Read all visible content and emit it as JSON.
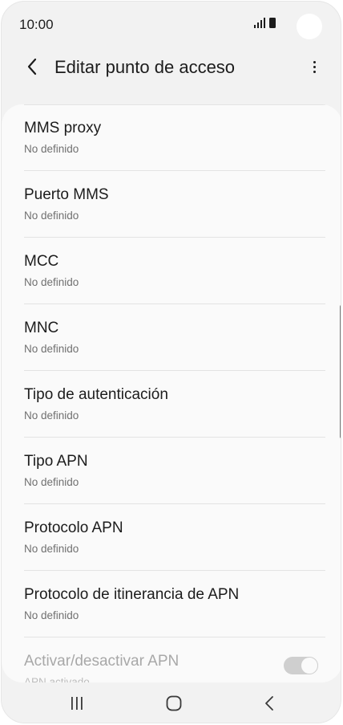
{
  "status_bar": {
    "time": "10:00"
  },
  "app_bar": {
    "title": "Editar punto de acceso"
  },
  "items": [
    {
      "title": "MMS proxy",
      "subtitle": "No definido"
    },
    {
      "title": "Puerto MMS",
      "subtitle": "No definido"
    },
    {
      "title": "MCC",
      "subtitle": "No definido"
    },
    {
      "title": "MNC",
      "subtitle": "No definido"
    },
    {
      "title": "Tipo de autenticación",
      "subtitle": "No definido"
    },
    {
      "title": "Tipo APN",
      "subtitle": "No definido"
    },
    {
      "title": "Protocolo APN",
      "subtitle": "No definido"
    },
    {
      "title": "Protocolo de itinerancia de APN",
      "subtitle": "No definido"
    },
    {
      "title": "Activar/desactivar APN",
      "subtitle": "APN activado"
    }
  ],
  "toggle": {
    "state": "on",
    "disabled": true
  },
  "icons": {
    "back": "back-arrow-icon",
    "more": "more-options-icon",
    "nav_recents": "recents-icon",
    "nav_home": "home-icon",
    "nav_back": "nav-back-icon"
  }
}
